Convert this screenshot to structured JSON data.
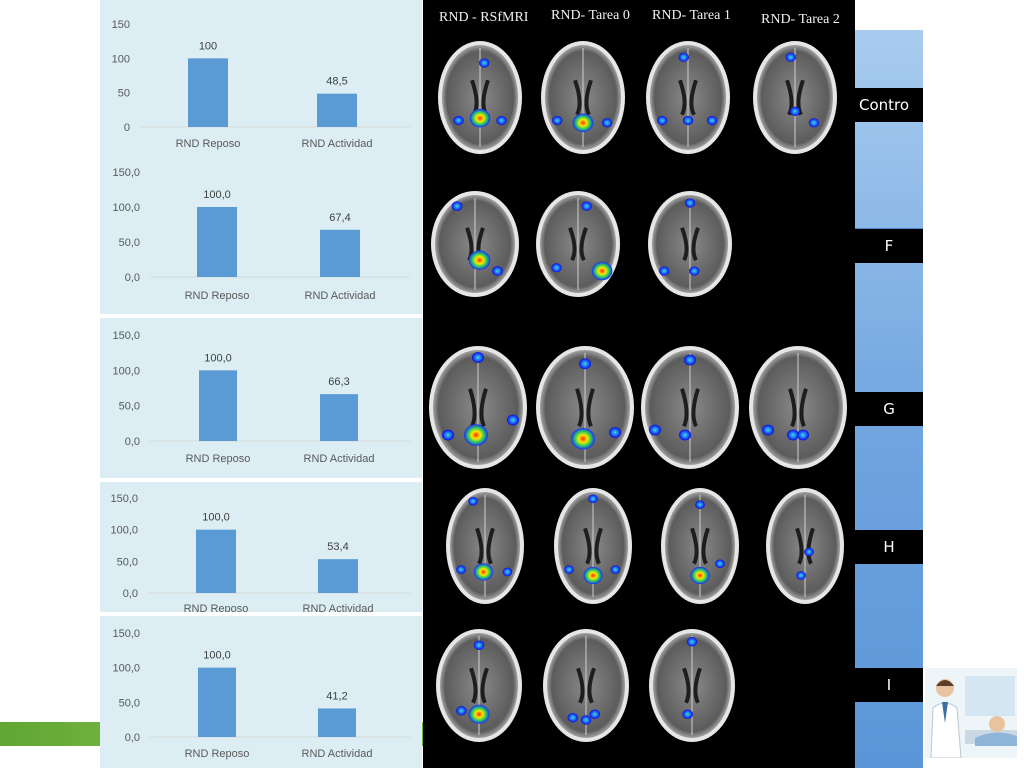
{
  "column_headers": [
    "RND - RSfMRI",
    "RND- Tarea 0",
    "RND- Tarea 1",
    "RND- Tarea 2"
  ],
  "group_labels": [
    "Contro",
    "F",
    "G",
    "H",
    "I"
  ],
  "colors": {
    "bar": "#5b9bd5",
    "panel_bg": "#dcedf4",
    "brain_bg": "#000000",
    "accent_green": "#6db33b"
  },
  "chart_data": [
    {
      "type": "bar",
      "categories": [
        "RND Reposo",
        "RND Actividad"
      ],
      "values": [
        100,
        48.5
      ],
      "value_labels": [
        "100",
        "48,5"
      ],
      "ylim": [
        0,
        150
      ],
      "yticks": [
        "0",
        "50",
        "100",
        "150"
      ]
    },
    {
      "type": "bar",
      "categories": [
        "RND Reposo",
        "RND Actividad"
      ],
      "values": [
        100.0,
        67.4
      ],
      "value_labels": [
        "100,0",
        "67,4"
      ],
      "ylim": [
        0,
        150
      ],
      "yticks": [
        "0,0",
        "50,0",
        "100,0",
        "150,0"
      ]
    },
    {
      "type": "bar",
      "categories": [
        "RND Reposo",
        "RND Actividad"
      ],
      "values": [
        100.0,
        66.3
      ],
      "value_labels": [
        "100,0",
        "66,3"
      ],
      "ylim": [
        0,
        150
      ],
      "yticks": [
        "0,0",
        "50,0",
        "100,0",
        "150,0"
      ]
    },
    {
      "type": "bar",
      "categories": [
        "RND Reposo",
        "RND Actividad"
      ],
      "values": [
        100.0,
        53.4
      ],
      "value_labels": [
        "100,0",
        "53,4"
      ],
      "ylim": [
        0,
        150
      ],
      "yticks": [
        "0,0",
        "50,0",
        "100,0",
        "150,0"
      ]
    },
    {
      "type": "bar",
      "categories": [
        "RND Reposo",
        "RND Actividad"
      ],
      "values": [
        100.0,
        41.2
      ],
      "value_labels": [
        "100,0",
        "41,2"
      ],
      "ylim": [
        0,
        150
      ],
      "yticks": [
        "0,0",
        "50,0",
        "100,0",
        "150,0"
      ]
    }
  ]
}
